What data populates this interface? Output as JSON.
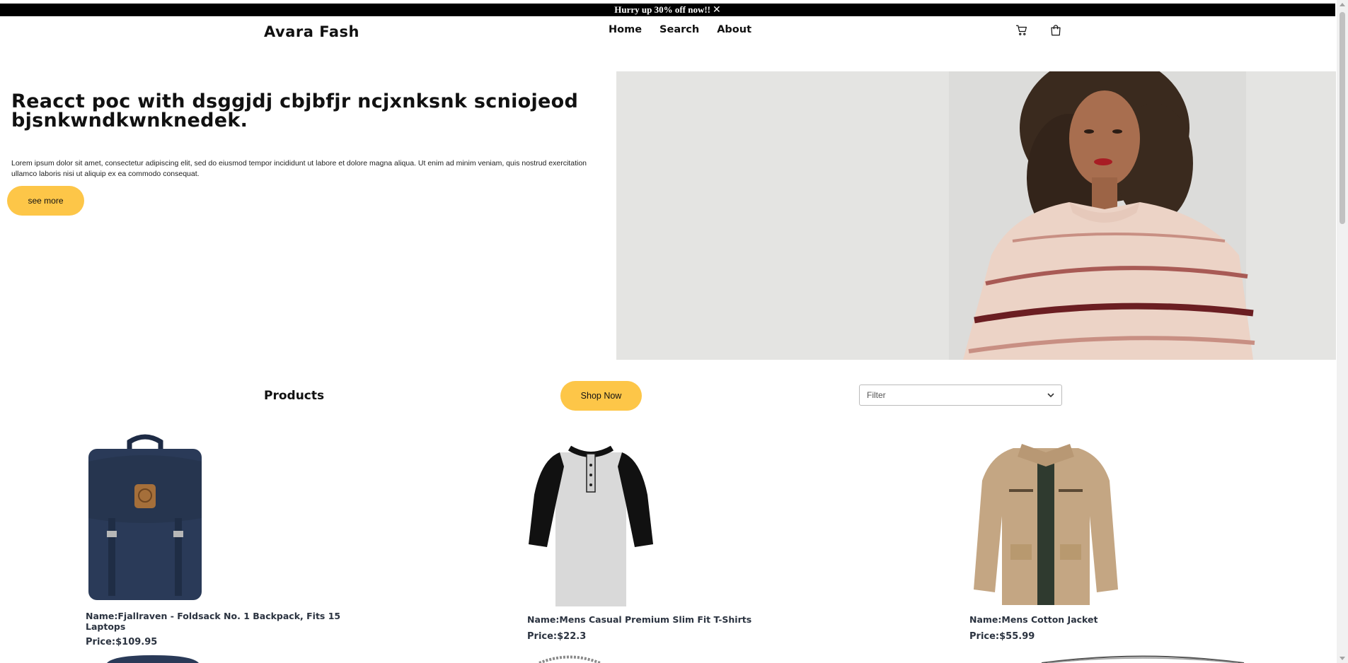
{
  "promo": {
    "text": "Hurry up 30% off now!!",
    "close_icon": "close-icon"
  },
  "header": {
    "brand": "Avara Fash",
    "nav": [
      "Home",
      "Search",
      "About"
    ],
    "icons": [
      "cart-icon",
      "bag-icon"
    ]
  },
  "hero": {
    "title": "Reacct poc with dsggjdj cbjbfjr ncjxnksnk scniojeod bjsnkwndkwnknedek.",
    "text": "Lorem ipsum dolor sit amet, consectetur adipiscing elit, sed do eiusmod tempor incididunt ut labore et dolore magna aliqua. Ut enim ad minim veniam, quis nostrud exercitation ullamco laboris nisi ut aliquip ex ea commodo consequat.",
    "button": "see more"
  },
  "products_section": {
    "heading": "Products",
    "shop_button": "Shop Now",
    "filter_placeholder": "Filter"
  },
  "products": [
    {
      "name": "Name:Fjallraven - Foldsack No. 1 Backpack, Fits 15 Laptops",
      "price": "Price:$109.95"
    },
    {
      "name": "Name:Mens Casual Premium Slim Fit T-Shirts",
      "price": "Price:$22.3"
    },
    {
      "name": "Name:Mens Cotton Jacket",
      "price": "Price:$55.99"
    }
  ],
  "colors": {
    "accent": "#fdc648",
    "promo_bg": "#000000",
    "product_text": "#2b3340"
  }
}
